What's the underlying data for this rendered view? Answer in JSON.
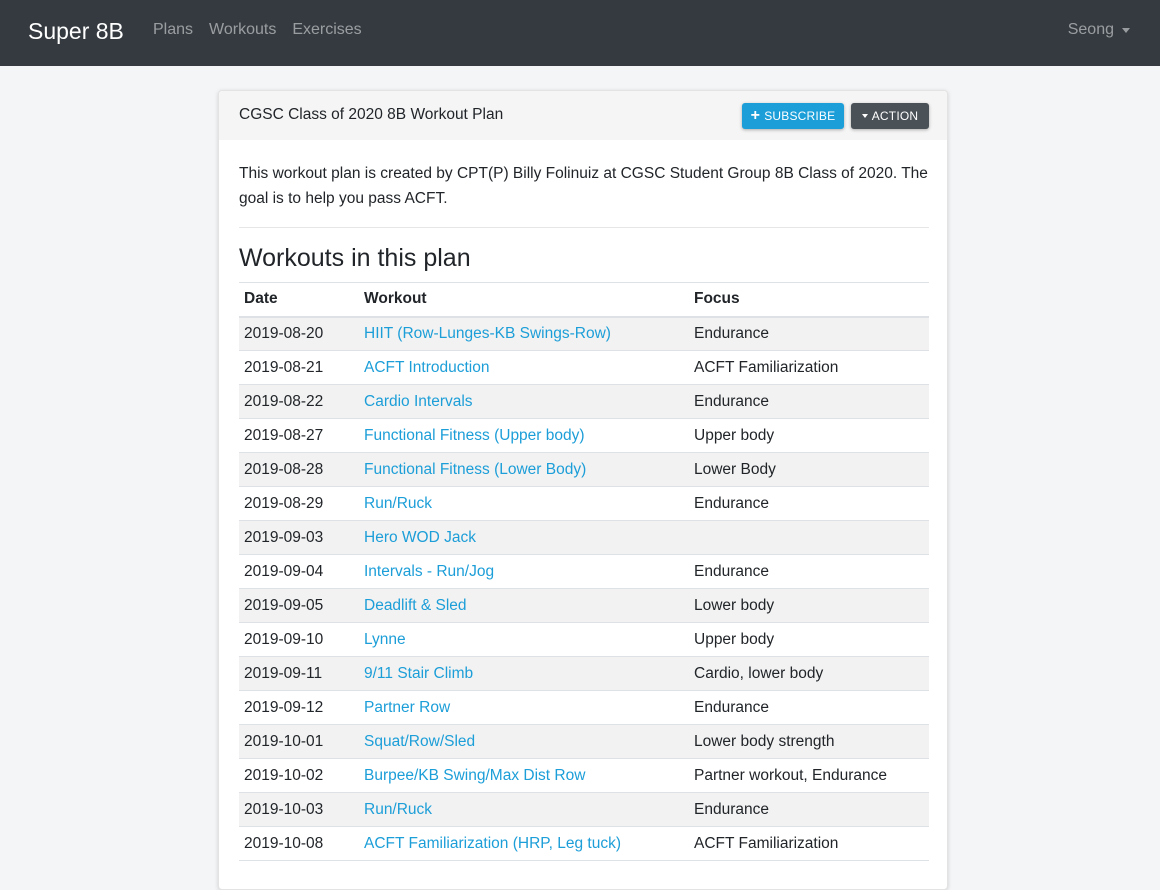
{
  "navbar": {
    "brand": "Super 8B",
    "links": [
      {
        "label": "Plans"
      },
      {
        "label": "Workouts"
      },
      {
        "label": "Exercises"
      }
    ],
    "user": "Seong"
  },
  "card": {
    "title": "CGSC Class of 2020 8B Workout Plan",
    "subscribe_label": "SUBSCRIBE",
    "action_label": "ACTION",
    "description": "This workout plan is created by CPT(P) Billy Folinuiz at CGSC Student Group 8B Class of 2020. The goal is to help you pass ACFT.",
    "section_title": "Workouts in this plan",
    "table": {
      "headers": {
        "date": "Date",
        "workout": "Workout",
        "focus": "Focus"
      },
      "rows": [
        {
          "date": "2019-08-20",
          "workout": "HIIT (Row-Lunges-KB Swings-Row)",
          "focus": "Endurance"
        },
        {
          "date": "2019-08-21",
          "workout": "ACFT Introduction",
          "focus": "ACFT Familiarization"
        },
        {
          "date": "2019-08-22",
          "workout": "Cardio Intervals",
          "focus": "Endurance"
        },
        {
          "date": "2019-08-27",
          "workout": "Functional Fitness (Upper body)",
          "focus": "Upper body"
        },
        {
          "date": "2019-08-28",
          "workout": "Functional Fitness (Lower Body)",
          "focus": "Lower Body"
        },
        {
          "date": "2019-08-29",
          "workout": "Run/Ruck",
          "focus": "Endurance"
        },
        {
          "date": "2019-09-03",
          "workout": "Hero WOD Jack",
          "focus": ""
        },
        {
          "date": "2019-09-04",
          "workout": "Intervals - Run/Jog",
          "focus": "Endurance"
        },
        {
          "date": "2019-09-05",
          "workout": "Deadlift & Sled",
          "focus": "Lower body"
        },
        {
          "date": "2019-09-10",
          "workout": "Lynne",
          "focus": "Upper body"
        },
        {
          "date": "2019-09-11",
          "workout": "9/11 Stair Climb",
          "focus": "Cardio, lower body"
        },
        {
          "date": "2019-09-12",
          "workout": "Partner Row",
          "focus": "Endurance"
        },
        {
          "date": "2019-10-01",
          "workout": "Squat/Row/Sled",
          "focus": "Lower body strength"
        },
        {
          "date": "2019-10-02",
          "workout": "Burpee/KB Swing/Max Dist Row",
          "focus": "Partner workout, Endurance"
        },
        {
          "date": "2019-10-03",
          "workout": "Run/Ruck",
          "focus": "Endurance"
        },
        {
          "date": "2019-10-08",
          "workout": "ACFT Familiarization (HRP, Leg tuck)",
          "focus": "ACFT Familiarization"
        }
      ]
    }
  },
  "colors": {
    "navbar_bg": "#343a40",
    "link": "#1c9ed8",
    "subscribe_bg": "#1c9ed8",
    "action_bg": "#4a5157"
  },
  "icons": {
    "subscribe": "plus-icon",
    "action": "caret-down-icon",
    "user_menu": "caret-down-icon"
  }
}
